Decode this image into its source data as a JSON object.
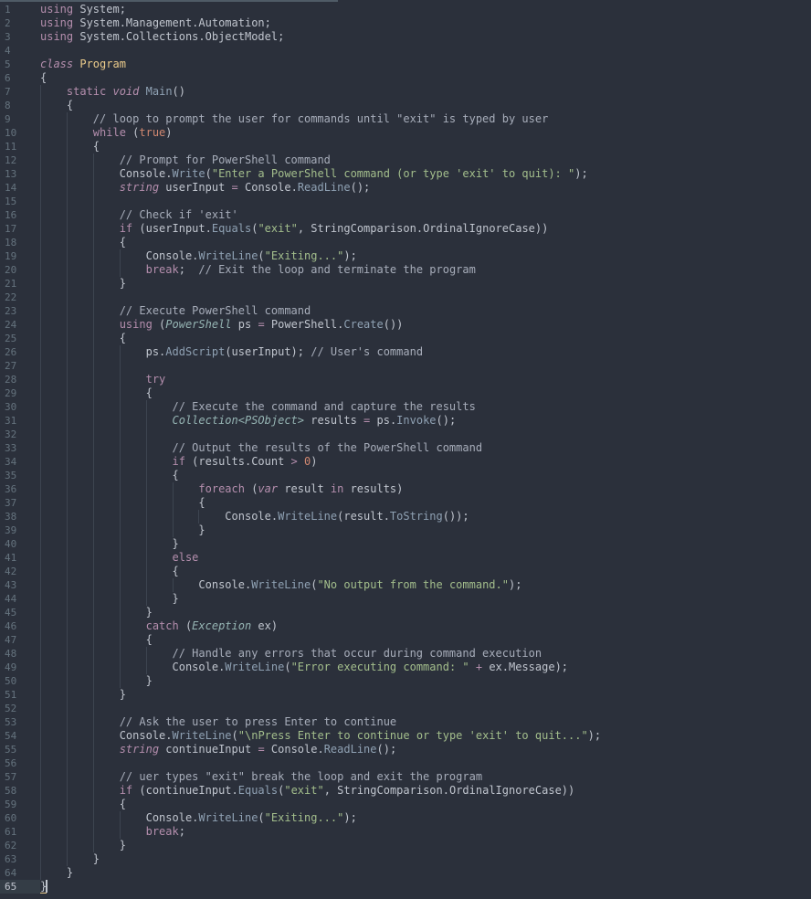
{
  "editor": {
    "line_numbers": [
      "1",
      "2",
      "3",
      "4",
      "5",
      "6",
      "7",
      "8",
      "9",
      "10",
      "11",
      "12",
      "13",
      "14",
      "15",
      "16",
      "17",
      "18",
      "19",
      "20",
      "21",
      "22",
      "23",
      "24",
      "25",
      "26",
      "27",
      "28",
      "29",
      "30",
      "31",
      "32",
      "33",
      "34",
      "35",
      "36",
      "37",
      "38",
      "39",
      "40",
      "41",
      "42",
      "43",
      "44",
      "45",
      "46",
      "47",
      "48",
      "49",
      "50",
      "51",
      "52",
      "53",
      "54",
      "55",
      "56",
      "57",
      "58",
      "59",
      "60",
      "61",
      "62",
      "63",
      "64",
      "65"
    ],
    "active_line": "65",
    "colors": {
      "background": "#2b303b",
      "keyword": "#b48ead",
      "type": "#ebcb8b",
      "function": "#8fa1b3",
      "string": "#a3be8c",
      "comment": "#a7adba"
    },
    "lines": [
      [
        [
          "kw",
          "using"
        ],
        [
          "",
          " System;"
        ]
      ],
      [
        [
          "kw",
          "using"
        ],
        [
          "",
          " System.Management.Automation;"
        ]
      ],
      [
        [
          "kw",
          "using"
        ],
        [
          "",
          " System.Collections.ObjectModel;"
        ]
      ],
      [],
      [
        [
          "kw-i",
          "class"
        ],
        [
          "",
          " "
        ],
        [
          "cls",
          "Program"
        ]
      ],
      [
        [
          "",
          "{"
        ]
      ],
      [
        [
          "",
          "    "
        ],
        [
          "kw",
          "static"
        ],
        [
          "",
          " "
        ],
        [
          "kw-i",
          "void"
        ],
        [
          "",
          " "
        ],
        [
          "fn",
          "Main"
        ],
        [
          "",
          "()"
        ]
      ],
      [
        [
          "",
          "    {"
        ]
      ],
      [
        [
          "",
          "        "
        ],
        [
          "cmt",
          "// loop to prompt the user for commands until \"exit\" is typed by user"
        ]
      ],
      [
        [
          "",
          "        "
        ],
        [
          "kw",
          "while"
        ],
        [
          "",
          " ("
        ],
        [
          "kw-o",
          "true"
        ],
        [
          "",
          ")"
        ]
      ],
      [
        [
          "",
          "        {"
        ]
      ],
      [
        [
          "",
          "            "
        ],
        [
          "cmt",
          "// Prompt for PowerShell command"
        ]
      ],
      [
        [
          "",
          "            Console."
        ],
        [
          "fn",
          "Write"
        ],
        [
          "",
          "("
        ],
        [
          "str",
          "\"Enter a PowerShell command (or type 'exit' to quit): \""
        ],
        [
          "",
          ");"
        ]
      ],
      [
        [
          "",
          "            "
        ],
        [
          "kw-i",
          "string"
        ],
        [
          "",
          " userInput "
        ],
        [
          "kw",
          "="
        ],
        [
          "",
          " Console."
        ],
        [
          "fn",
          "ReadLine"
        ],
        [
          "",
          "();"
        ]
      ],
      [],
      [
        [
          "",
          "            "
        ],
        [
          "cmt",
          "// Check if 'exit'"
        ]
      ],
      [
        [
          "",
          "            "
        ],
        [
          "kw",
          "if"
        ],
        [
          "",
          " (userInput."
        ],
        [
          "fn",
          "Equals"
        ],
        [
          "",
          "("
        ],
        [
          "str",
          "\"exit\""
        ],
        [
          "",
          ", StringComparison.OrdinalIgnoreCase))"
        ]
      ],
      [
        [
          "",
          "            {"
        ]
      ],
      [
        [
          "",
          "                Console."
        ],
        [
          "fn",
          "WriteLine"
        ],
        [
          "",
          "("
        ],
        [
          "str",
          "\"Exiting...\""
        ],
        [
          "",
          ");"
        ]
      ],
      [
        [
          "",
          "                "
        ],
        [
          "kw",
          "break"
        ],
        [
          "",
          ";  "
        ],
        [
          "cmt",
          "// Exit the loop and terminate the program"
        ]
      ],
      [
        [
          "",
          "            }"
        ]
      ],
      [],
      [
        [
          "",
          "            "
        ],
        [
          "cmt",
          "// Execute PowerShell command"
        ]
      ],
      [
        [
          "",
          "            "
        ],
        [
          "kw",
          "using"
        ],
        [
          "",
          " ("
        ],
        [
          "type-i",
          "PowerShell"
        ],
        [
          "",
          " ps "
        ],
        [
          "kw",
          "="
        ],
        [
          "",
          " PowerShell."
        ],
        [
          "fn",
          "Create"
        ],
        [
          "",
          "())"
        ]
      ],
      [
        [
          "",
          "            {"
        ]
      ],
      [
        [
          "",
          "                ps."
        ],
        [
          "fn",
          "AddScript"
        ],
        [
          "",
          "(userInput); "
        ],
        [
          "cmt",
          "// User's command"
        ]
      ],
      [],
      [
        [
          "",
          "                "
        ],
        [
          "kw",
          "try"
        ]
      ],
      [
        [
          "",
          "                {"
        ]
      ],
      [
        [
          "",
          "                    "
        ],
        [
          "cmt",
          "// Execute the command and capture the results"
        ]
      ],
      [
        [
          "",
          "                    "
        ],
        [
          "type-i",
          "Collection<PSObject>"
        ],
        [
          "",
          " results "
        ],
        [
          "kw",
          "="
        ],
        [
          "",
          " ps."
        ],
        [
          "fn",
          "Invoke"
        ],
        [
          "",
          "();"
        ]
      ],
      [],
      [
        [
          "",
          "                    "
        ],
        [
          "cmt",
          "// Output the results of the PowerShell command"
        ]
      ],
      [
        [
          "",
          "                    "
        ],
        [
          "kw",
          "if"
        ],
        [
          "",
          " (results.Count "
        ],
        [
          "kw",
          "&gt;"
        ],
        [
          "",
          " "
        ],
        [
          "num",
          "0"
        ],
        [
          "",
          ")"
        ]
      ],
      [
        [
          "",
          "                    {"
        ]
      ],
      [
        [
          "",
          "                        "
        ],
        [
          "kw",
          "foreach"
        ],
        [
          "",
          " ("
        ],
        [
          "kw-i",
          "var"
        ],
        [
          "",
          " result "
        ],
        [
          "kw",
          "in"
        ],
        [
          "",
          " results)"
        ]
      ],
      [
        [
          "",
          "                        {"
        ]
      ],
      [
        [
          "",
          "                            Console."
        ],
        [
          "fn",
          "WriteLine"
        ],
        [
          "",
          "(result."
        ],
        [
          "fn",
          "ToString"
        ],
        [
          "",
          "());"
        ]
      ],
      [
        [
          "",
          "                        }"
        ]
      ],
      [
        [
          "",
          "                    }"
        ]
      ],
      [
        [
          "",
          "                    "
        ],
        [
          "kw",
          "else"
        ]
      ],
      [
        [
          "",
          "                    {"
        ]
      ],
      [
        [
          "",
          "                        Console."
        ],
        [
          "fn",
          "WriteLine"
        ],
        [
          "",
          "("
        ],
        [
          "str",
          "\"No output from the command.\""
        ],
        [
          "",
          ");"
        ]
      ],
      [
        [
          "",
          "                    }"
        ]
      ],
      [
        [
          "",
          "                }"
        ]
      ],
      [
        [
          "",
          "                "
        ],
        [
          "kw",
          "catch"
        ],
        [
          "",
          " ("
        ],
        [
          "type-i",
          "Exception"
        ],
        [
          "",
          " ex)"
        ]
      ],
      [
        [
          "",
          "                {"
        ]
      ],
      [
        [
          "",
          "                    "
        ],
        [
          "cmt",
          "// Handle any errors that occur during command execution"
        ]
      ],
      [
        [
          "",
          "                    Console."
        ],
        [
          "fn",
          "WriteLine"
        ],
        [
          "",
          "("
        ],
        [
          "str",
          "\"Error executing command: \""
        ],
        [
          "",
          " "
        ],
        [
          "kw",
          "+"
        ],
        [
          "",
          " ex.Message);"
        ]
      ],
      [
        [
          "",
          "                }"
        ]
      ],
      [
        [
          "",
          "            }"
        ]
      ],
      [],
      [
        [
          "",
          "            "
        ],
        [
          "cmt",
          "// Ask the user to press Enter to continue"
        ]
      ],
      [
        [
          "",
          "            Console."
        ],
        [
          "fn",
          "WriteLine"
        ],
        [
          "",
          "("
        ],
        [
          "str",
          "\"\\nPress Enter to continue or type 'exit' to quit...\""
        ],
        [
          "",
          ");"
        ]
      ],
      [
        [
          "",
          "            "
        ],
        [
          "kw-i",
          "string"
        ],
        [
          "",
          " continueInput "
        ],
        [
          "kw",
          "="
        ],
        [
          "",
          " Console."
        ],
        [
          "fn",
          "ReadLine"
        ],
        [
          "",
          "();"
        ]
      ],
      [],
      [
        [
          "",
          "            "
        ],
        [
          "cmt",
          "// uer types \"exit\" break the loop and exit the program"
        ]
      ],
      [
        [
          "",
          "            "
        ],
        [
          "kw",
          "if"
        ],
        [
          "",
          " (continueInput."
        ],
        [
          "fn",
          "Equals"
        ],
        [
          "",
          "("
        ],
        [
          "str",
          "\"exit\""
        ],
        [
          "",
          ", StringComparison.OrdinalIgnoreCase))"
        ]
      ],
      [
        [
          "",
          "            {"
        ]
      ],
      [
        [
          "",
          "                Console."
        ],
        [
          "fn",
          "WriteLine"
        ],
        [
          "",
          "("
        ],
        [
          "str",
          "\"Exiting...\""
        ],
        [
          "",
          ");"
        ]
      ],
      [
        [
          "",
          "                "
        ],
        [
          "kw",
          "break"
        ],
        [
          "",
          ";"
        ]
      ],
      [
        [
          "",
          "            }"
        ]
      ],
      [
        [
          "",
          "        }"
        ]
      ],
      [
        [
          "",
          "    }"
        ]
      ],
      [
        [
          "cursor-brace",
          "}"
        ]
      ]
    ]
  }
}
